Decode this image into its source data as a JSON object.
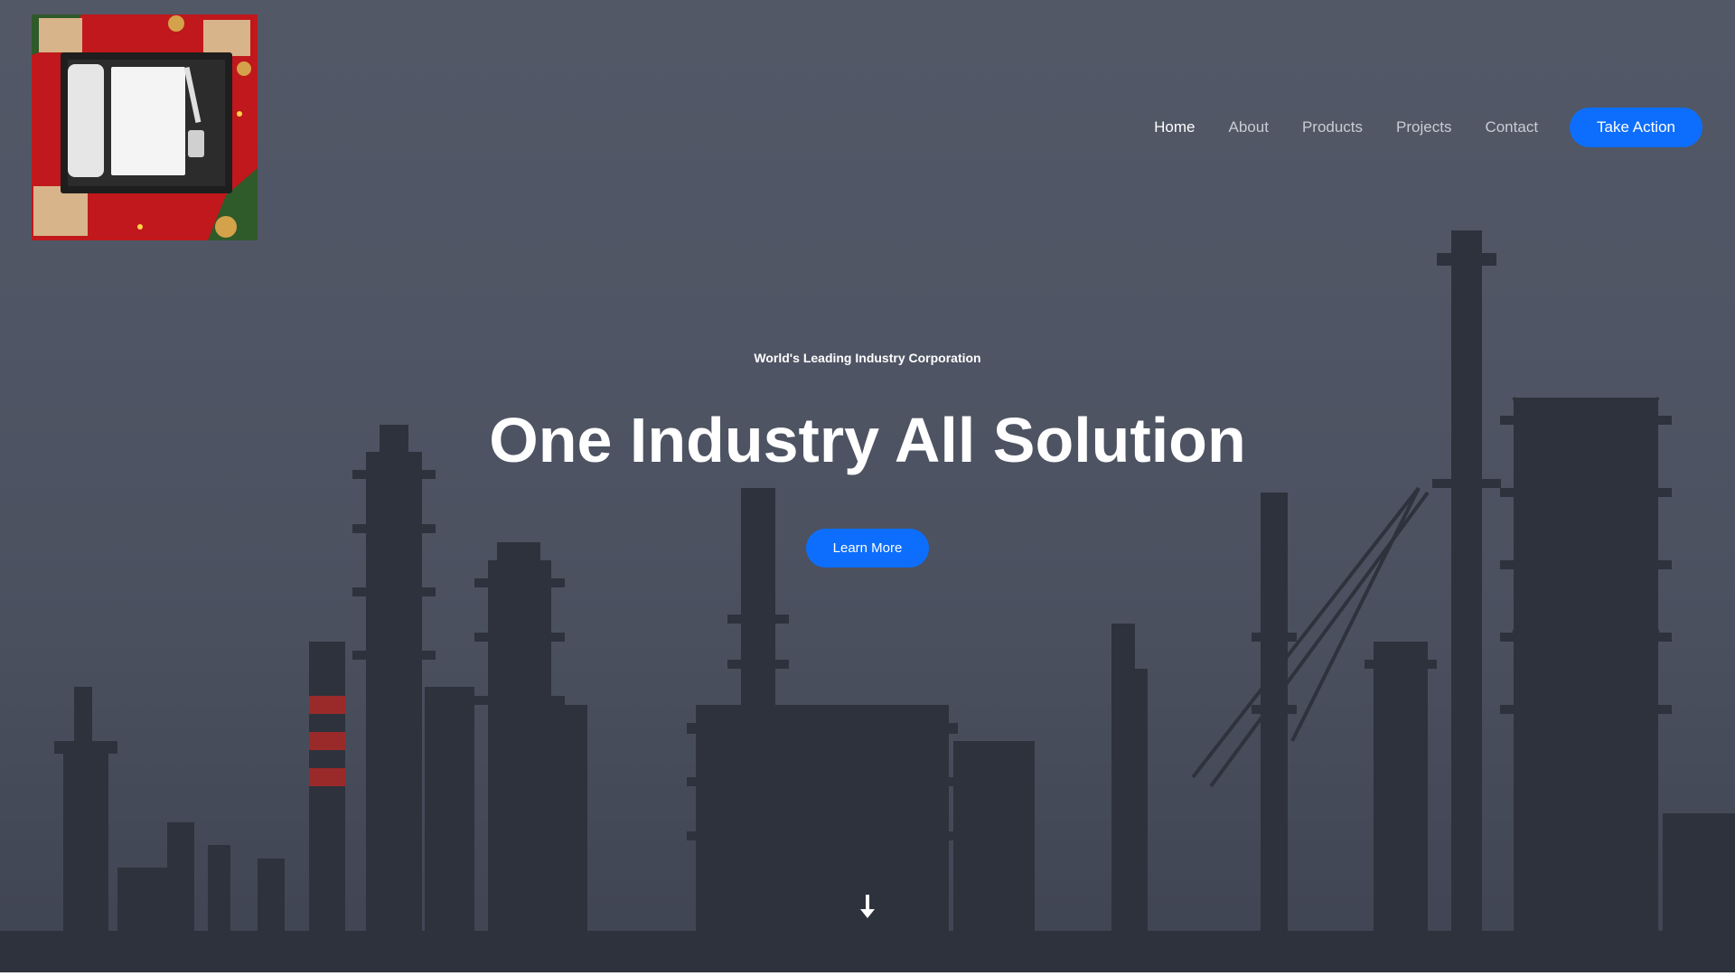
{
  "logo": {
    "icon": "gift-box-product-photo",
    "colors": {
      "background": "#c0181c",
      "box": "#1e1e1e",
      "items": "#f2f2f2",
      "gold": "#d4a24a",
      "pine": "#2f5a2a"
    }
  },
  "nav": {
    "items": [
      {
        "label": "Home",
        "active": true
      },
      {
        "label": "About",
        "active": false
      },
      {
        "label": "Products",
        "active": false
      },
      {
        "label": "Projects",
        "active": false
      },
      {
        "label": "Contact",
        "active": false
      }
    ],
    "cta_label": "Take Action"
  },
  "hero": {
    "eyebrow": "World's Leading Industry Corporation",
    "headline": "One Industry All Solution",
    "button_label": "Learn More",
    "scroll_icon": "arrow-down-icon",
    "background_icon": "industrial-refinery-skyline"
  },
  "colors": {
    "accent": "#0d6efd",
    "overlay": "#4f5564",
    "text": "#ffffff",
    "nav_text": "#c9ccd3"
  }
}
